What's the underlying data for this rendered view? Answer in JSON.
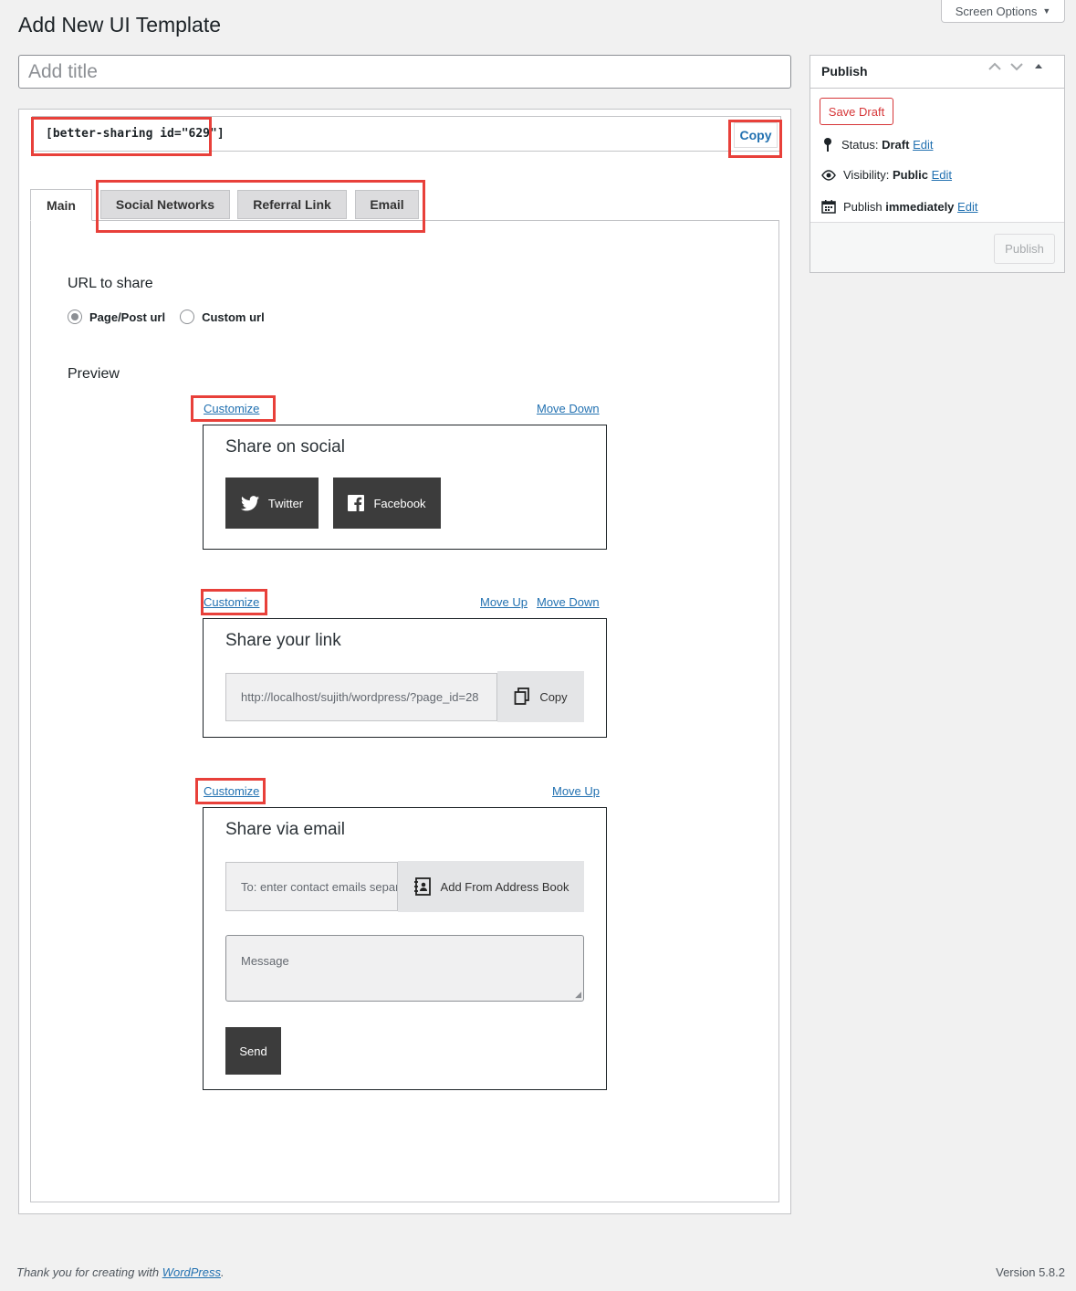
{
  "screen_options": {
    "label": "Screen Options"
  },
  "page_title": "Add New UI Template",
  "title_input": {
    "placeholder": "Add title",
    "value": ""
  },
  "shortcode": {
    "text": "[better-sharing id=\"629\"]",
    "copy_label": "Copy"
  },
  "tabs": [
    {
      "label": "Main",
      "active": true
    },
    {
      "label": "Social Networks",
      "active": false
    },
    {
      "label": "Referral Link",
      "active": false
    },
    {
      "label": "Email",
      "active": false
    }
  ],
  "url_section": {
    "label": "URL to share",
    "options": [
      {
        "label": "Page/Post url",
        "checked": true
      },
      {
        "label": "Custom url",
        "checked": false
      }
    ]
  },
  "preview": {
    "label": "Preview",
    "social": {
      "customize": "Customize",
      "move_down": "Move Down",
      "title": "Share on social",
      "buttons": [
        {
          "label": "Twitter",
          "icon": "twitter-icon"
        },
        {
          "label": "Facebook",
          "icon": "facebook-icon"
        }
      ]
    },
    "link": {
      "customize": "Customize",
      "move_up": "Move Up",
      "move_down": "Move Down",
      "title": "Share your link",
      "url_value": "http://localhost/sujith/wordpress/?page_id=28",
      "copy_label": "Copy"
    },
    "email": {
      "customize": "Customize",
      "move_up": "Move Up",
      "title": "Share via email",
      "to_placeholder": "To: enter contact emails separated by comma",
      "address_book_label": "Add From Address Book",
      "message_placeholder": "Message",
      "send_label": "Send"
    }
  },
  "publish": {
    "title": "Publish",
    "save_draft": "Save Draft",
    "status_label": "Status:",
    "status_value": "Draft",
    "visibility_label": "Visibility:",
    "visibility_value": "Public",
    "schedule_label": "Publish",
    "schedule_value": "immediately",
    "edit_label": "Edit",
    "publish_button": "Publish"
  },
  "footer": {
    "thanks_prefix": "Thank you for creating with",
    "wordpress_link": "WordPress",
    "thanks_suffix": ".",
    "version": "Version 5.8.2"
  },
  "colors": {
    "highlight": "#e8403a",
    "link": "#2271b1",
    "dark_button": "#3c3c3c",
    "save_draft": "#d63638"
  }
}
